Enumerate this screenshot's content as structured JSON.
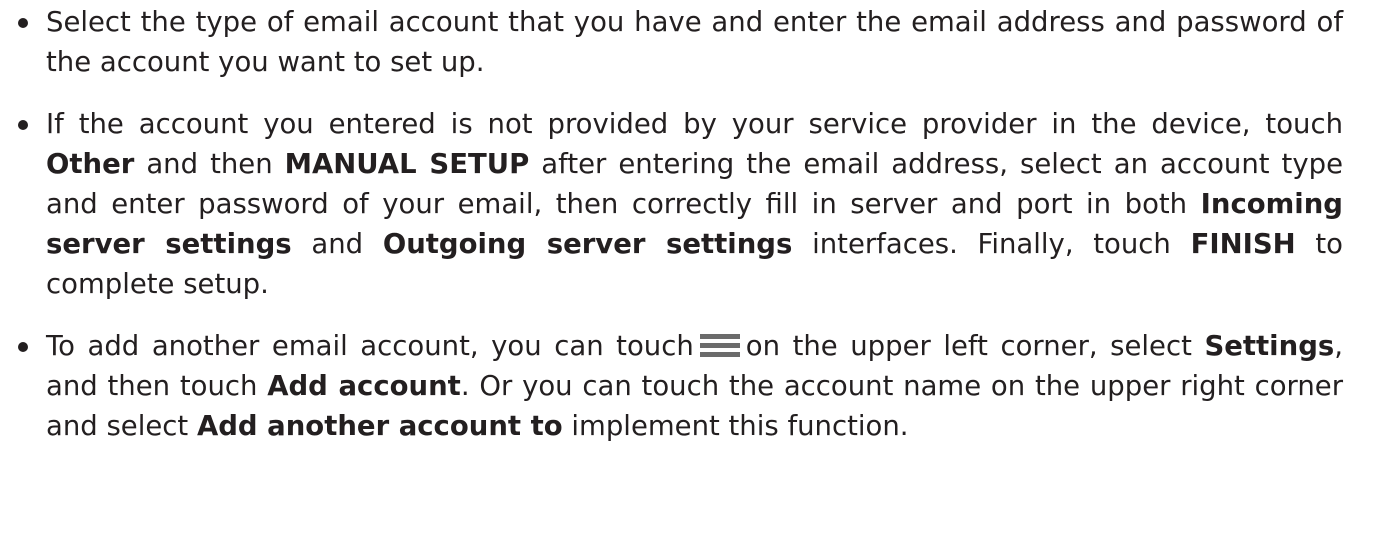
{
  "bullets": [
    {
      "text": "Select the type of email account that you have and enter the email address and password of the account you want to set up."
    },
    {
      "t1": "If the account you entered is not provided by your service provider in the device, touch ",
      "b1": "Other",
      "t2": " and then ",
      "b2": "MANUAL SETUP",
      "t3": " after entering the email address, select an account type and enter password of your email, then correctly fill in server and port in both ",
      "b3": "Incoming server settings",
      "t4": " and ",
      "b4": "Outgoing server settings",
      "t5": " interfaces. Finally, touch ",
      "b5": "FINISH",
      "t6": " to complete setup."
    },
    {
      "t1": "To add another email account, you can touch",
      "icon": "menu-icon",
      "t2": "on the upper left corner, select ",
      "b1": "Settings",
      "t3": ", and then touch ",
      "b2": "Add account",
      "t4": ". Or you can touch the account name on the upper right corner and select ",
      "b3": "Add another account to",
      "t5": " implement this function."
    }
  ]
}
